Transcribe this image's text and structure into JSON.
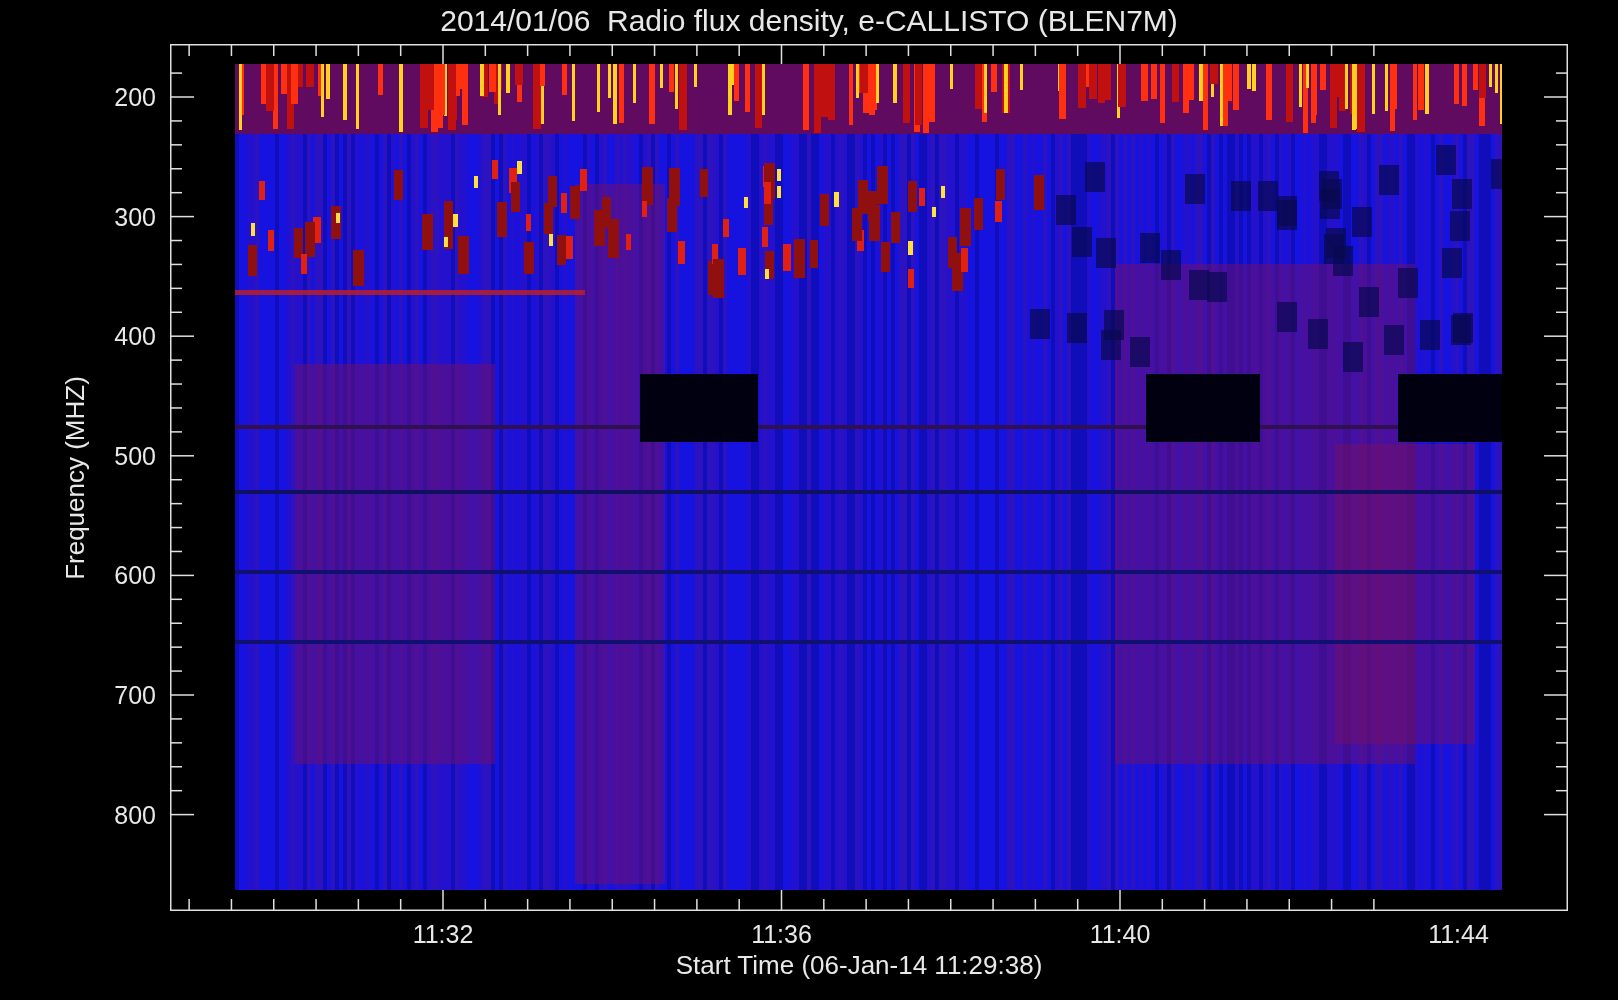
{
  "title": "2014/01/06  Radio flux density, e-CALLISTO (BLEN7M)",
  "y_axis": {
    "label": "Frequency (MHZ)",
    "ticks": [
      "200",
      "300",
      "400",
      "500",
      "600",
      "700",
      "800"
    ]
  },
  "x_axis": {
    "label": "Start Time (06-Jan-14 11:29:38)",
    "ticks": [
      "11:32",
      "11:36",
      "11:40",
      "11:44"
    ]
  }
}
